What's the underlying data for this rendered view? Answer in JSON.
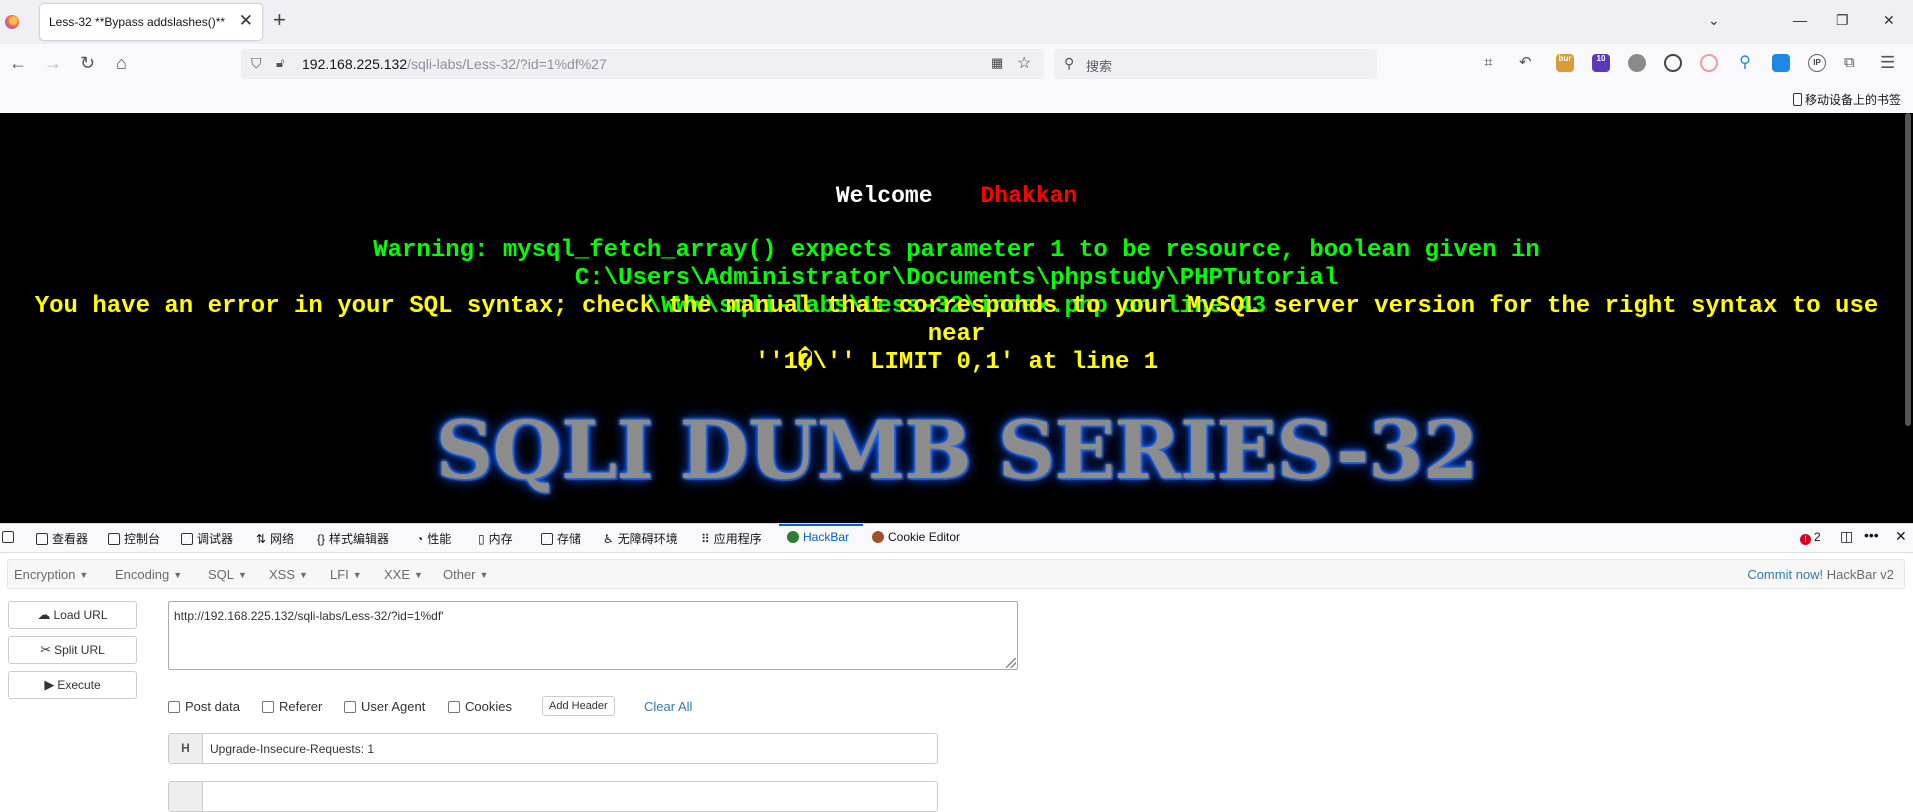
{
  "browser": {
    "tab_title": "Less-32 **Bypass addslashes()**",
    "url_host": "192.168.225.132",
    "url_path": "/sqli-labs/Less-32/?id=1%df%27",
    "search_placeholder": "搜索",
    "mobile_bookmarks": "移动设备上的书签",
    "ext_badge_1": "bur",
    "ext_badge_2": "10",
    "ext_ip": "IP"
  },
  "page": {
    "welcome": "Welcome",
    "name": "Dhakkan",
    "warning_line1": "Warning: mysql_fetch_array() expects parameter 1 to be resource, boolean given in C:\\Users\\Administrator\\Documents\\phpstudy\\PHPTutorial",
    "warning_line2": "\\WWW\\sqli-labs\\Less-32\\index.php on line 43",
    "error_line1": "You have an error in your SQL syntax; check the manual that corresponds to your MySQL server version for the right syntax to use near",
    "error_line2": "''1�\\'' LIMIT 0,1' at line 1",
    "banner": "SQLI DUMB SERIES-32"
  },
  "devtools": {
    "tabs": [
      "查看器",
      "控制台",
      "调试器",
      "网络",
      "样式编辑器",
      "性能",
      "内存",
      "存储",
      "无障碍环境",
      "应用程序",
      "HackBar",
      "Cookie Editor"
    ],
    "error_count": "2"
  },
  "hackbar": {
    "menus": [
      "Encryption",
      "Encoding",
      "SQL",
      "XSS",
      "LFI",
      "XXE",
      "Other"
    ],
    "commit_link": "Commit now!",
    "version": "HackBar v2",
    "load_url": "Load URL",
    "split_url": "Split URL",
    "execute": "Execute",
    "url_value": "http://192.168.225.132/sqli-labs/Less-32/?id=1%df'",
    "checkboxes": [
      "Post data",
      "Referer",
      "User Agent",
      "Cookies"
    ],
    "add_header": "Add Header",
    "clear_all": "Clear All",
    "header_label": "H",
    "header_value": "Upgrade-Insecure-Requests: 1"
  }
}
